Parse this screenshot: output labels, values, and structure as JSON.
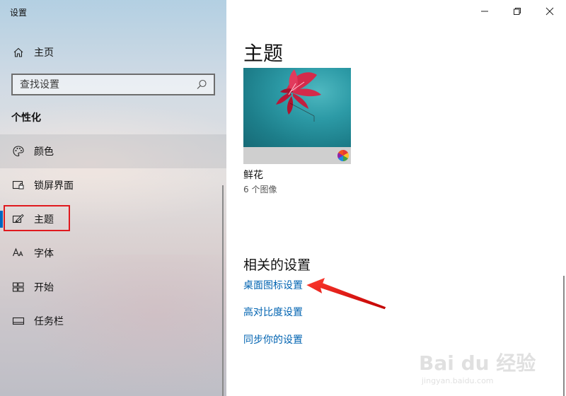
{
  "app": {
    "title": "设置"
  },
  "sidebar": {
    "home_label": "主页",
    "search_placeholder": "查找设置",
    "section_title": "个性化",
    "items": [
      {
        "label": "颜色",
        "icon": "palette-icon"
      },
      {
        "label": "锁屏界面",
        "icon": "lock-screen-icon"
      },
      {
        "label": "主题",
        "icon": "theme-brush-icon",
        "active": true
      },
      {
        "label": "字体",
        "icon": "font-icon"
      },
      {
        "label": "开始",
        "icon": "start-icon"
      },
      {
        "label": "任务栏",
        "icon": "taskbar-icon"
      }
    ]
  },
  "main": {
    "title": "主题",
    "theme": {
      "name": "鲜花",
      "count": "6 个图像"
    },
    "related_title": "相关的设置",
    "links": [
      "桌面图标设置",
      "高对比度设置",
      "同步你的设置"
    ]
  },
  "watermark": {
    "brand": "Bai du 经验",
    "url": "jingyan.baidu.com"
  },
  "colors": {
    "accent": "#0067c0",
    "link": "#0063b1",
    "highlight": "#e0191e"
  }
}
